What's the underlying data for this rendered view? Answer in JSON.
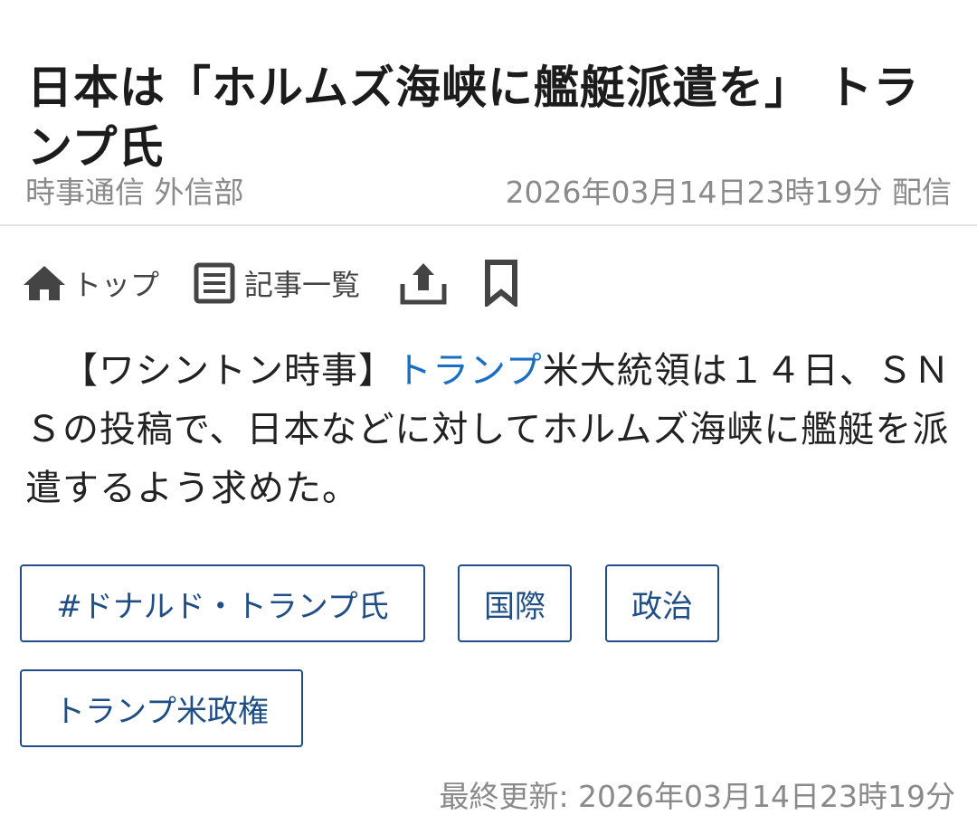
{
  "article": {
    "headline": "日本は「ホルムズ海峡に艦艇派遣を」 トランプ氏",
    "source": "時事通信 外信部",
    "published": "2026年03月14日23時19分 配信",
    "body_prefix": "【ワシントン時事】",
    "body_link": "トランプ",
    "body_rest": "米大統領は１４日、ＳＮＳの投稿で、日本などに対してホルムズ海峡に艦艇を派遣するよう求めた。",
    "updated": "最終更新: 2026年03月14日23時19分"
  },
  "toolbar": {
    "top_label": "トップ",
    "list_label": "記事一覧",
    "share_icon": "share-icon",
    "bookmark_icon": "bookmark-icon"
  },
  "tags": [
    "#ドナルド・トランプ氏",
    "国際",
    "政治",
    "トランプ米政権"
  ],
  "colors": {
    "link": "#1a6fc4",
    "tag_border": "#1f4e86",
    "muted_text": "#8a8a8a"
  }
}
